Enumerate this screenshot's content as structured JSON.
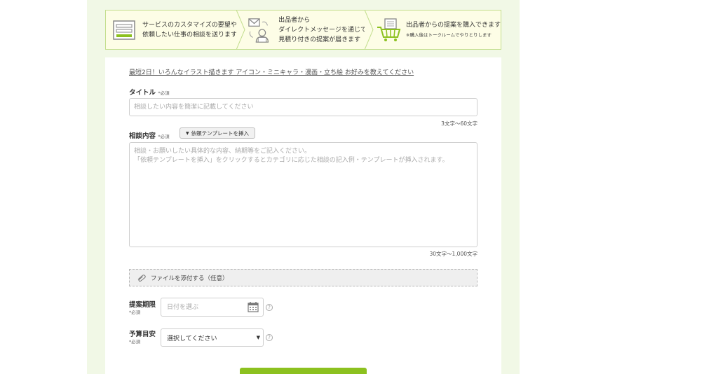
{
  "steps": [
    {
      "line1": "サービスのカスタマイズの要望や",
      "line2": "依頼したい仕事の相談を送ります",
      "icon": "form-icon"
    },
    {
      "line1": "出品者から",
      "line2": "ダイレクトメッセージを通じて",
      "line3": "見積り付きの提案が届きます",
      "icon": "message-person-icon"
    },
    {
      "line1": "出品者からの提案を購入できます",
      "note": "※購入後はトークルームでやりとりします",
      "icon": "cart-icon"
    }
  ],
  "notice_link": "最短2日！いろんなイラスト描きます アイコン・ミニキャラ・漫画・立ち絵 お好みを教えてください",
  "title_field": {
    "label": "タイトル",
    "required": "*必須",
    "placeholder": "相談したい内容を簡潔に記載してください",
    "counter": "3文字〜60文字"
  },
  "content_field": {
    "label": "相談内容",
    "required": "*必須",
    "template_button": "依頼テンプレートを挿入",
    "placeholder": "相談・お願いしたい具体的な内容、納期等をご記入ください。\n「依頼テンプレートを挿入」をクリックするとカテゴリに応じた相談の記入例・テンプレートが挿入されます。",
    "counter": "30文字〜1,000文字"
  },
  "attach": {
    "label": "ファイルを添付する（任意）",
    "icon": "paperclip-icon"
  },
  "deadline_field": {
    "label": "提案期限",
    "required": "*必須",
    "placeholder": "日付を選ぶ",
    "icon": "calendar-icon",
    "help": "?"
  },
  "budget_field": {
    "label": "予算目安",
    "required": "*必須",
    "selected": "選択してください",
    "help": "?"
  },
  "colors": {
    "accent": "#8cc11f",
    "banner_bg": "#fdfde6",
    "banner_border": "#c3de8e",
    "page_bg": "#f1f8e6"
  }
}
